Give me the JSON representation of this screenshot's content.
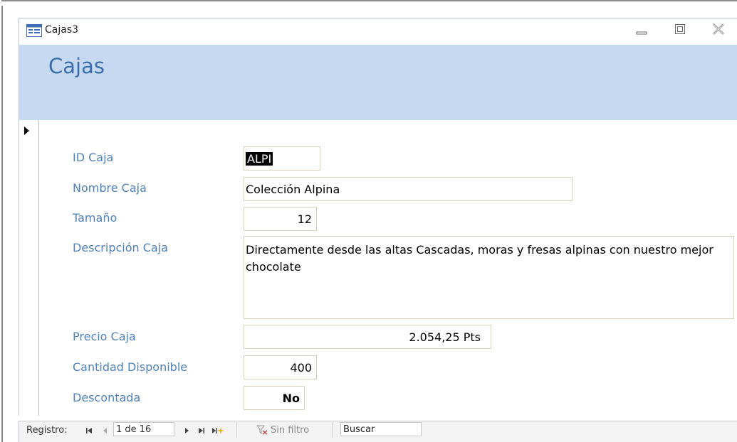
{
  "window": {
    "title": "Cajas3",
    "form_icon": "form-icon",
    "minimize_icon": "minimize-icon",
    "restore_icon": "restore-icon",
    "close_icon": "close-icon"
  },
  "header": {
    "title": "Cajas"
  },
  "record_selector_icon": "record-selector-arrow-icon",
  "form": {
    "id_label": "ID Caja",
    "id_value": "ALPI",
    "nombre_label": "Nombre Caja",
    "nombre_value": "Colección Alpina",
    "tamano_label": "Tamaño",
    "tamano_value": "12",
    "descripcion_label": "Descripción Caja",
    "descripcion_value": "Directamente desde las altas Cascadas, moras  y fresas alpinas con nuestro mejor chocolate",
    "precio_label": "Precio Caja",
    "precio_value": "2.054,25 Pts",
    "cantidad_label": "Cantidad Disponible",
    "cantidad_value": "400",
    "descontada_label": "Descontada",
    "descontada_value": "No"
  },
  "navigation": {
    "registro_label": "Registro:",
    "record_position": "1 de 16",
    "filter_label": "Sin filtro",
    "search_text": "Buscar",
    "icons": [
      "first-record-icon",
      "previous-record-icon",
      "next-record-icon",
      "last-record-icon",
      "new-record-icon",
      "filter-icon"
    ]
  },
  "colors": {
    "header_band": "#c6d9f1",
    "header_title": "#3b6eaa",
    "label": "#4f81bd",
    "field_border": "#d8d0b8"
  }
}
